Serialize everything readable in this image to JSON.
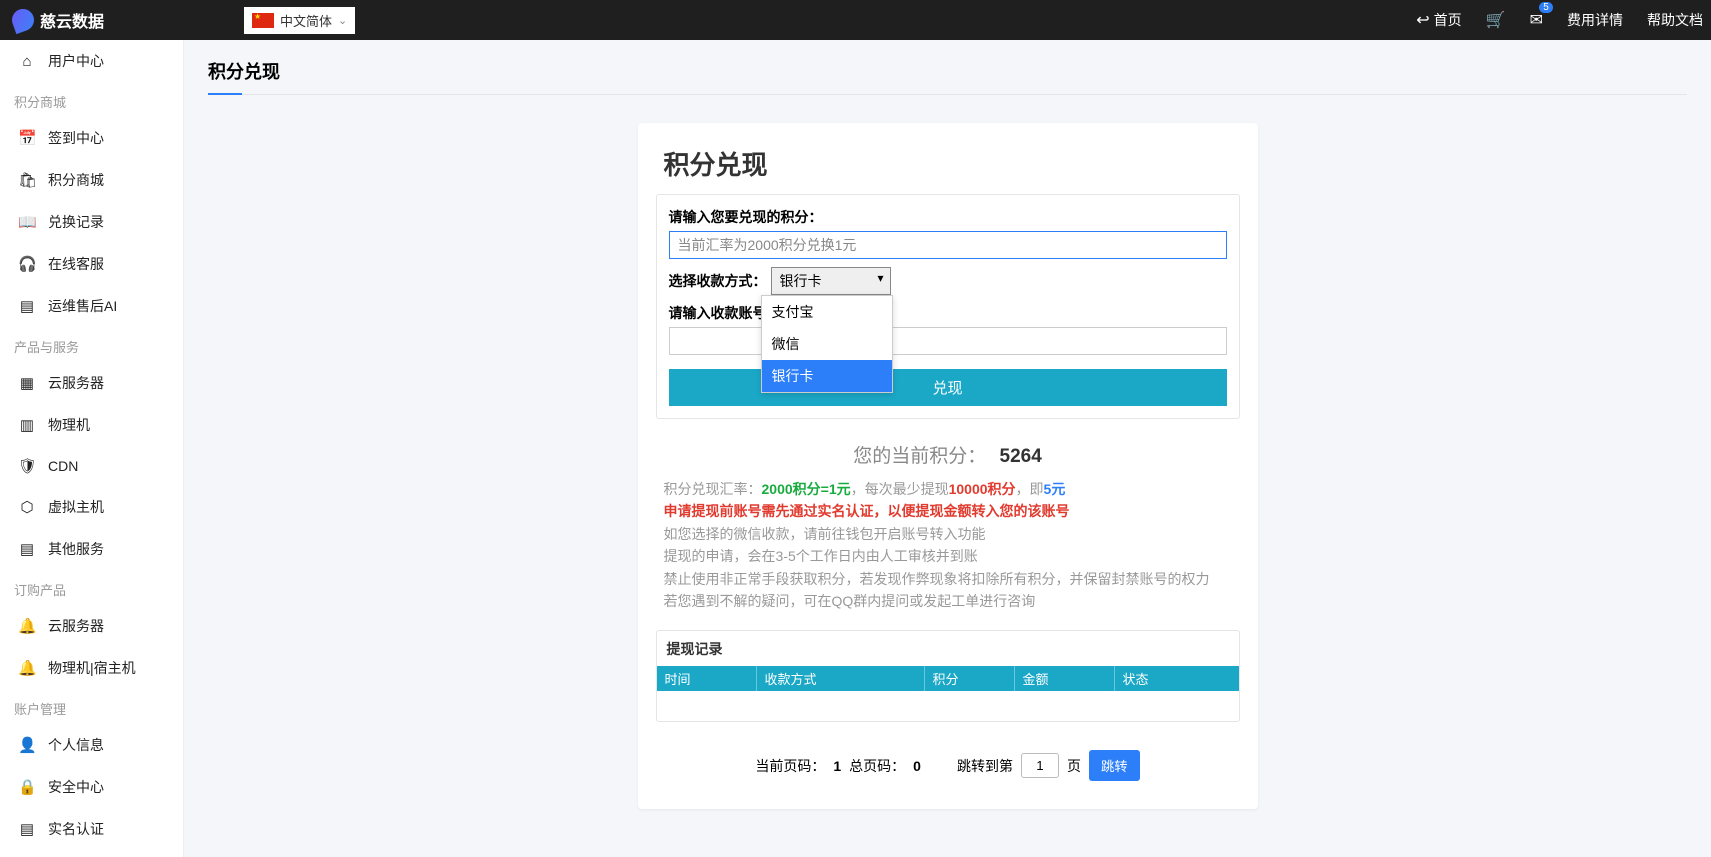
{
  "brand": "慈云数据",
  "lang": "中文简体",
  "topnav": {
    "home": "首页",
    "badge": "5",
    "billing": "费用详情",
    "help": "帮助文档"
  },
  "sidebar": {
    "user_center": "用户中心",
    "grp_mall": "积分商城",
    "checkin": "签到中心",
    "mall": "积分商城",
    "exchange_log": "兑换记录",
    "support": "在线客服",
    "ops_ai": "运维售后AI",
    "grp_services": "产品与服务",
    "cloud_server": "云服务器",
    "bare_metal": "物理机",
    "cdn": "CDN",
    "vhost": "虚拟主机",
    "other_svc": "其他服务",
    "grp_orders": "订购产品",
    "ord_cloud": "云服务器",
    "ord_bare": "物理机|宿主机",
    "grp_account": "账户管理",
    "profile": "个人信息",
    "security": "安全中心",
    "realname": "实名认证"
  },
  "page": {
    "title": "积分兑现",
    "card_title": "积分兑现",
    "label_points": "请输入您要兑现的积分：",
    "placeholder_points": "当前汇率为2000积分兑换1元",
    "label_method": "选择收款方式：",
    "method_selected": "银行卡",
    "method_options": [
      "支付宝",
      "微信",
      "银行卡"
    ],
    "label_account": "请输入收款账号",
    "submit": "兑现",
    "balance_label": "您的当前积分：",
    "balance_value": "5264",
    "info": {
      "l1_a": "积分兑现汇率：",
      "l1_b": "2000积分=1元",
      "l1_c": "，每次最少提现",
      "l1_d": "10000积分",
      "l1_e": "，即",
      "l1_f": "5元",
      "l2": "申请提现前账号需先通过实名认证，以便提现金额转入您的该账号",
      "l3": "如您选择的微信收款，请前往钱包开启账号转入功能",
      "l4": "提现的申请，会在3-5个工作日内由人工审核并到账",
      "l5": "禁止使用非正常手段获取积分，若发现作弊现象将扣除所有积分，并保留封禁账号的权力",
      "l6": "若您遇到不解的疑问，可在QQ群内提问或发起工单进行咨询"
    },
    "records": {
      "title": "提现记录",
      "cols": {
        "time": "时间",
        "method": "收款方式",
        "points": "积分",
        "amount": "金额",
        "status": "状态"
      }
    },
    "pager": {
      "cur_label": "当前页码：",
      "cur": "1",
      "total_label": "总页码：",
      "total": "0",
      "jump_label": "跳转到第",
      "jump_val": "1",
      "page_word": "页",
      "jump_btn": "跳转"
    }
  }
}
